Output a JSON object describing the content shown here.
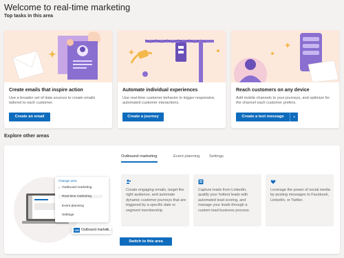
{
  "header": {
    "title": "Welcome to real-time marketing",
    "subtitle": "Top tasks in this area"
  },
  "cards": [
    {
      "title": "Create emails that inspire action",
      "description": "Use a broader set of data sources to create emails tailored to each customer.",
      "button": "Create an email"
    },
    {
      "title": "Automate individual experiences",
      "description": "Use real-time customer behavior to trigger responsive, automated customer interactions.",
      "button": "Create a journey"
    },
    {
      "title": "Reach customers on any device",
      "description": "Add mobile channels to your journeys, and optimize for the channel each customer prefers.",
      "button": "Create a text message"
    }
  ],
  "explore": {
    "title": "Explore other areas",
    "tabs": [
      "Outbound marketing",
      "Event planning",
      "Settings"
    ],
    "tiles": [
      {
        "icon": "people-icon",
        "text": "Create engaging emails, target the right audience, and automate dynamic customer journeys that are triggered by a specific date or segment membership."
      },
      {
        "icon": "leads-icon",
        "text": "Capture leads from LinkedIn, qualify your hottest leads with automated lead scoring, and manage your leads through a custom lead business process."
      },
      {
        "icon": "heart-icon",
        "text": "Leverage the power of social media by posting messages to Facebook, LinkedIn, or Twitter."
      }
    ],
    "switch_button": "Switch to this area",
    "illustration": {
      "menu_header": "Change area",
      "menu_items": [
        "Outbound marketing",
        "Real-time marketing",
        "Event planning",
        "Settings"
      ],
      "dropdown_badge": "OM",
      "dropdown_label": "Outbound marketi..."
    }
  },
  "colors": {
    "accent": "#0f6cbd",
    "page_bg": "#f3f2f1",
    "card_art_bg": "#fde7d9",
    "purple": "#8a6fd1"
  }
}
